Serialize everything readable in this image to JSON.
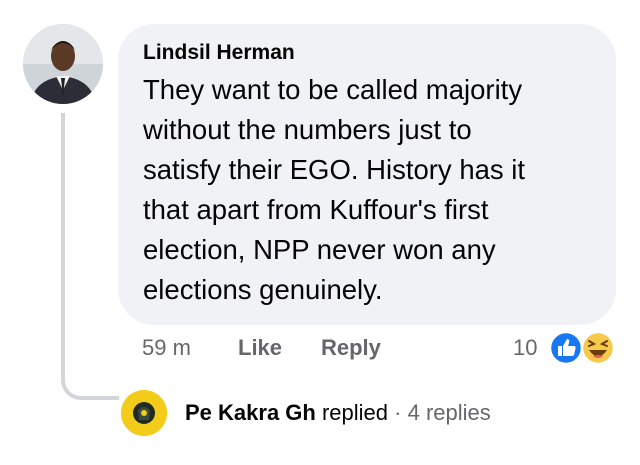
{
  "comment": {
    "author": "Lindsil Herman",
    "text": "They want to be called majority\nwithout the numbers just to\nsatisfy their EGO. History has it\nthat apart from Kuffour's first\nelection, NPP never won any\nelections genuinely.",
    "timestamp": "59 m",
    "like_label": "Like",
    "reply_label": "Reply",
    "reaction_count": "10",
    "reactions": [
      "like-reaction-icon",
      "haha-reaction-icon"
    ],
    "colors": {
      "bubble": "#f0f2f5",
      "like_blue": "#1877f2",
      "haha_yellow": "#f7c94b",
      "meta_gray": "#65676b"
    }
  },
  "replies": {
    "replier": "Pe Kakra Gh",
    "verb": "replied",
    "separator": "·",
    "count_label": "4 replies",
    "avatar_color": "#f3cc1a"
  }
}
